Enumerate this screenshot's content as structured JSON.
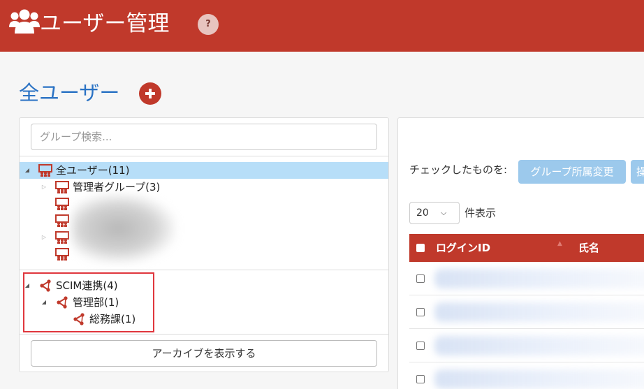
{
  "header": {
    "title": "ユーザー管理",
    "help_label": "?",
    "background_color": "#c0392b",
    "icon": "users-icon"
  },
  "page": {
    "title": "全ユーザー",
    "add_icon": "plus-circle-icon"
  },
  "group_search": {
    "placeholder": "グループ検索..."
  },
  "tree": {
    "groups": [
      {
        "label": "全ユーザー(11)",
        "expanded": true,
        "selected": true,
        "icon": "group-icon"
      },
      {
        "label": "管理者グループ(3)",
        "expanded": false,
        "icon": "group-icon"
      },
      {
        "label": "",
        "icon": "group-icon",
        "blurred": true
      },
      {
        "label": "",
        "icon": "group-icon",
        "blurred": true
      },
      {
        "label": "",
        "expanded": false,
        "icon": "group-icon",
        "blurred": true
      },
      {
        "label": "",
        "icon": "group-icon",
        "blurred": true
      }
    ],
    "scim": [
      {
        "label": "SCIM連携(4)",
        "expanded": true,
        "icon": "share-nodes-icon"
      },
      {
        "label": "管理部(1)",
        "expanded": true,
        "icon": "share-nodes-icon"
      },
      {
        "label": "総務課(1)",
        "icon": "share-nodes-icon"
      }
    ],
    "archive_button": "アーカイブを表示する"
  },
  "bulk": {
    "label": "チェックしたものを:",
    "buttons": [
      "グループ所属変更",
      "操"
    ]
  },
  "per_page": {
    "value": "20",
    "label": "件表示"
  },
  "table": {
    "headers": [
      "ログインID",
      "氏名"
    ],
    "sort_icon": "sort-up-icon",
    "row_count": 4
  },
  "colors": {
    "accent_red": "#c0392b",
    "title_blue": "#2a72c4",
    "selected_row": "#b7def8",
    "disabled_button": "#9cc9ec",
    "highlight_border": "#e0363d"
  }
}
